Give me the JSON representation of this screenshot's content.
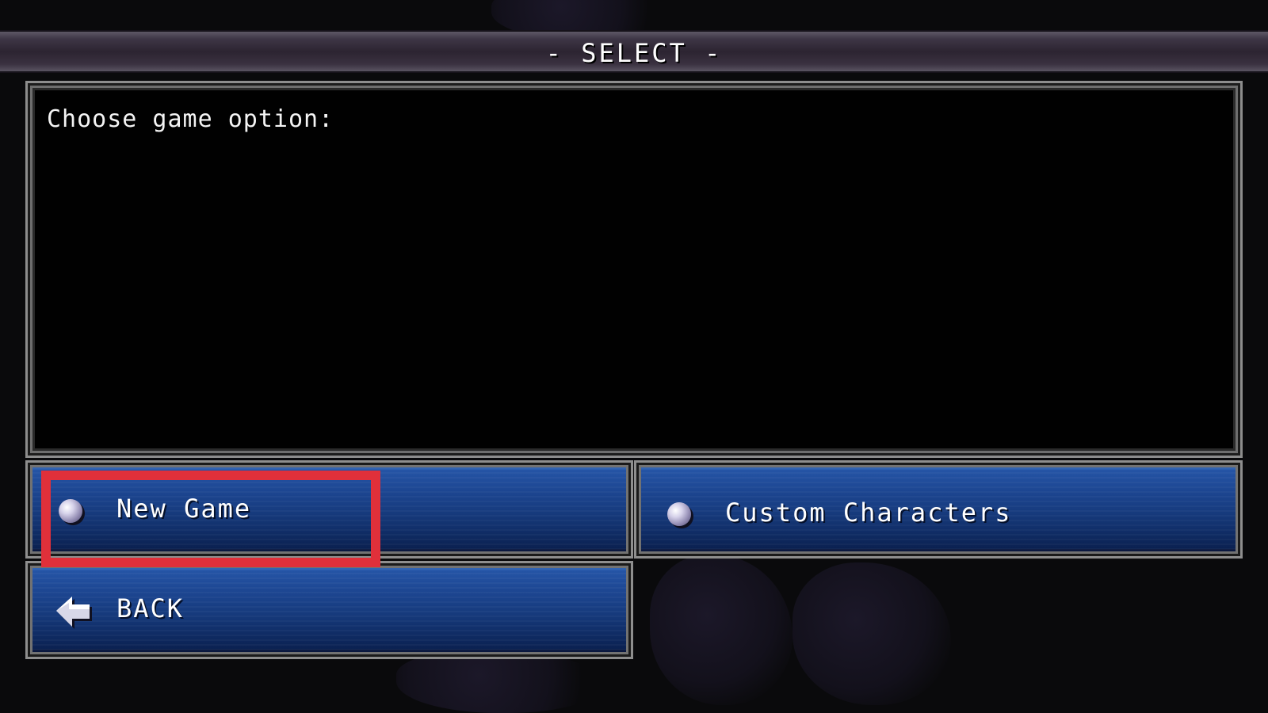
{
  "header": {
    "title": "- SELECT -"
  },
  "message": {
    "text": "Choose game option:"
  },
  "options": [
    {
      "label": "New Game",
      "icon": "orb-icon"
    },
    {
      "label": "Custom Characters",
      "icon": "orb-icon"
    }
  ],
  "back": {
    "label": "BACK",
    "icon": "back-arrow-icon"
  },
  "colors": {
    "button_blue": "#1c4590",
    "highlight_red": "#e0303a",
    "header_purple": "#2c2431"
  }
}
